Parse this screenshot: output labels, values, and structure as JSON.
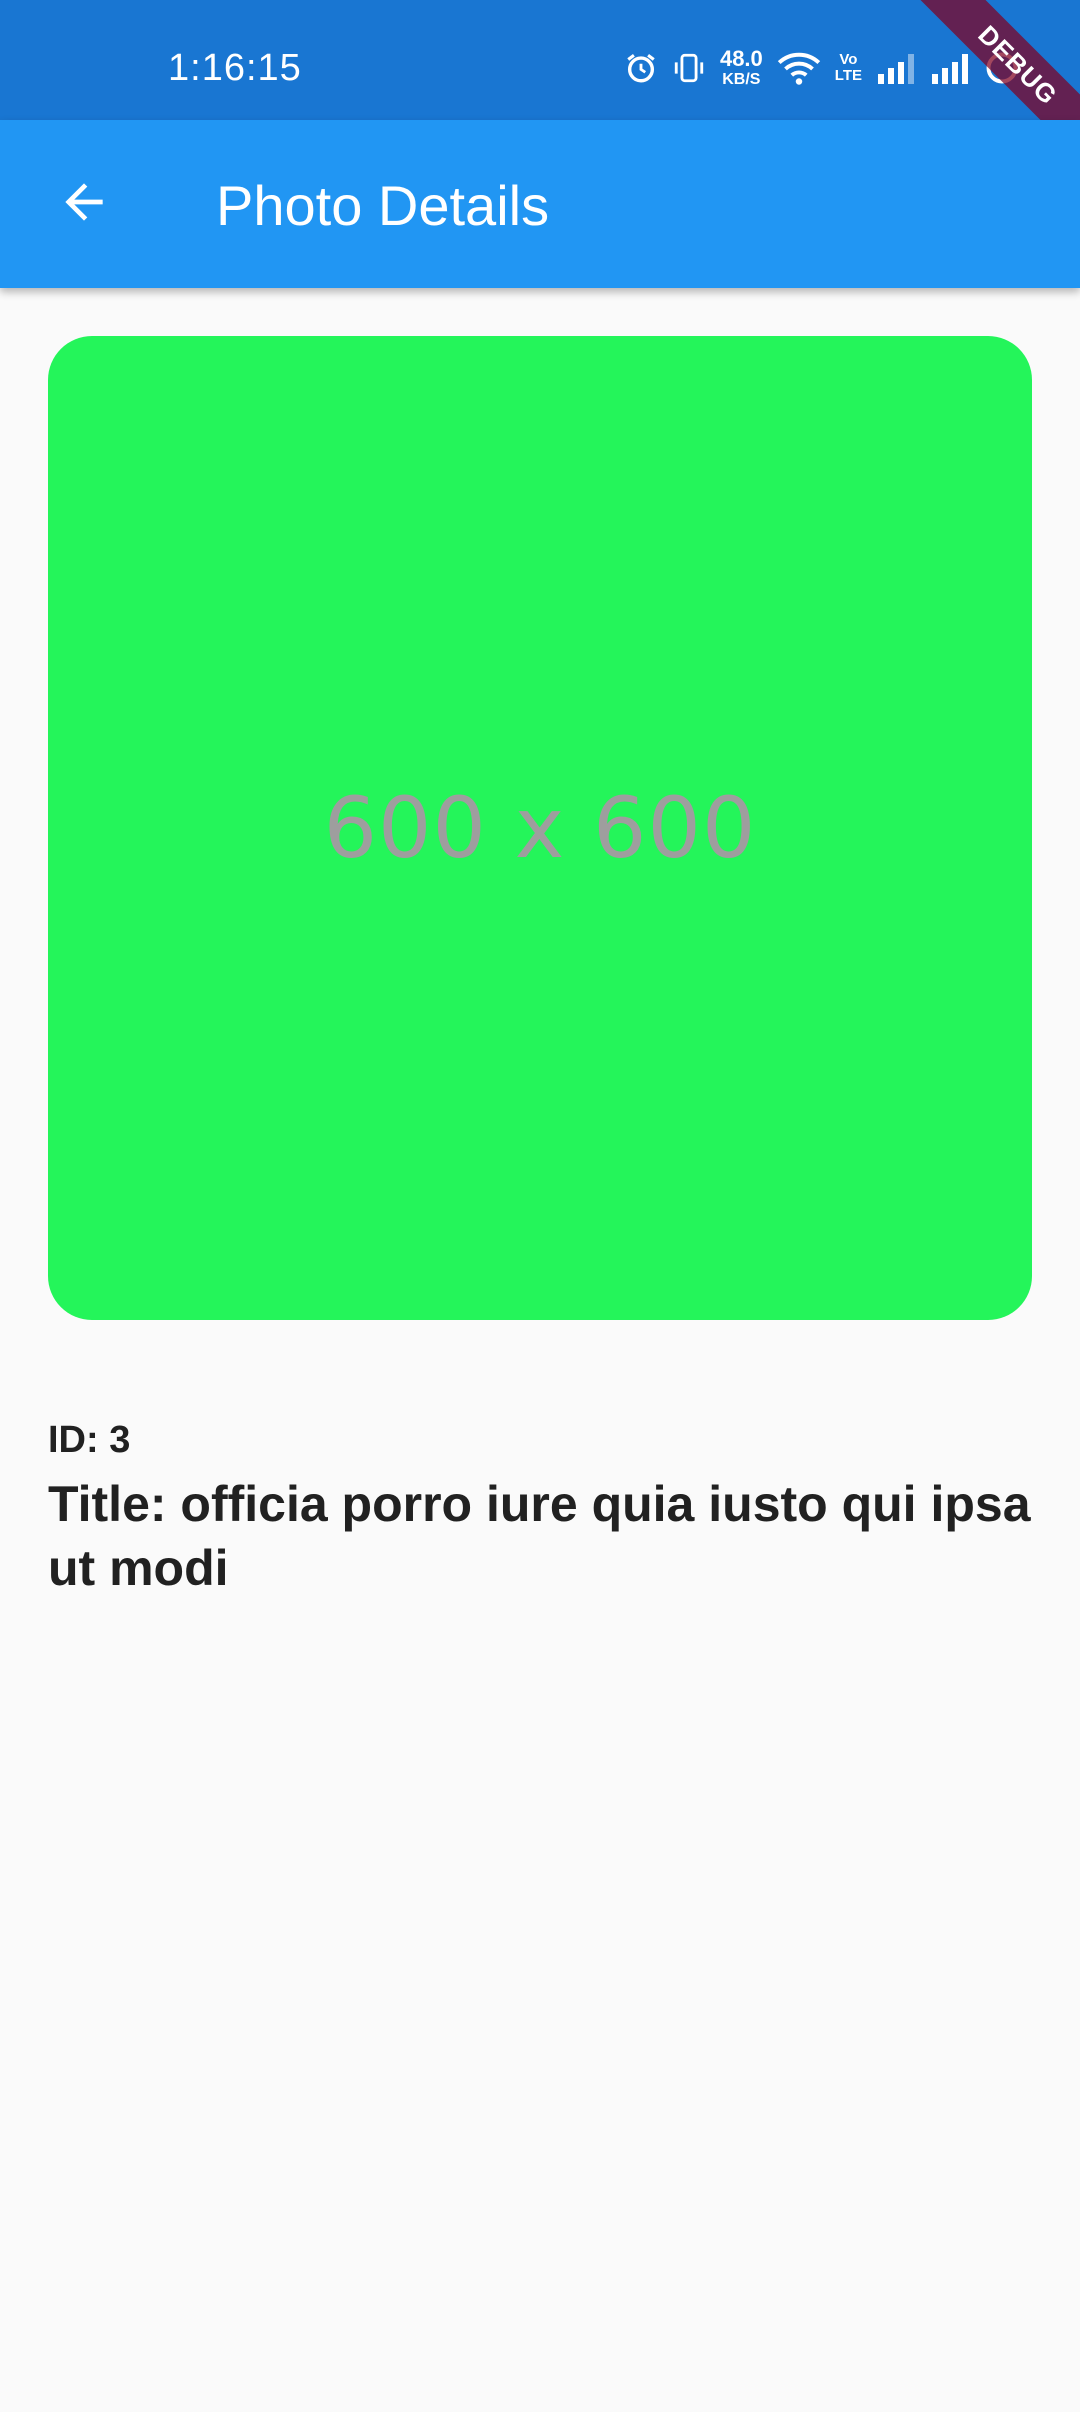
{
  "status_bar": {
    "time": "1:16:15",
    "net_speed_value": "48.0",
    "net_speed_unit": "KB/S",
    "volte_top": "Vo",
    "volte_bottom": "LTE",
    "icons": [
      "alarm-icon",
      "vibrate-icon",
      "wifi-icon",
      "volte-icon",
      "signal-icon",
      "signal-icon",
      "battery-icon"
    ]
  },
  "debug_banner": {
    "label": "DEBUG"
  },
  "app_bar": {
    "title": "Photo Details",
    "back_icon": "arrow-back-icon"
  },
  "photo": {
    "placeholder_text": "600 x 600",
    "background_color": "#24f55a"
  },
  "details": {
    "id_text": "ID: 3",
    "title_text": "Title: officia porro iure quia iusto qui ipsa ut modi"
  },
  "colors": {
    "status_bar": "#1976d2",
    "app_bar": "#2196f3",
    "page_background": "#fafafa"
  }
}
